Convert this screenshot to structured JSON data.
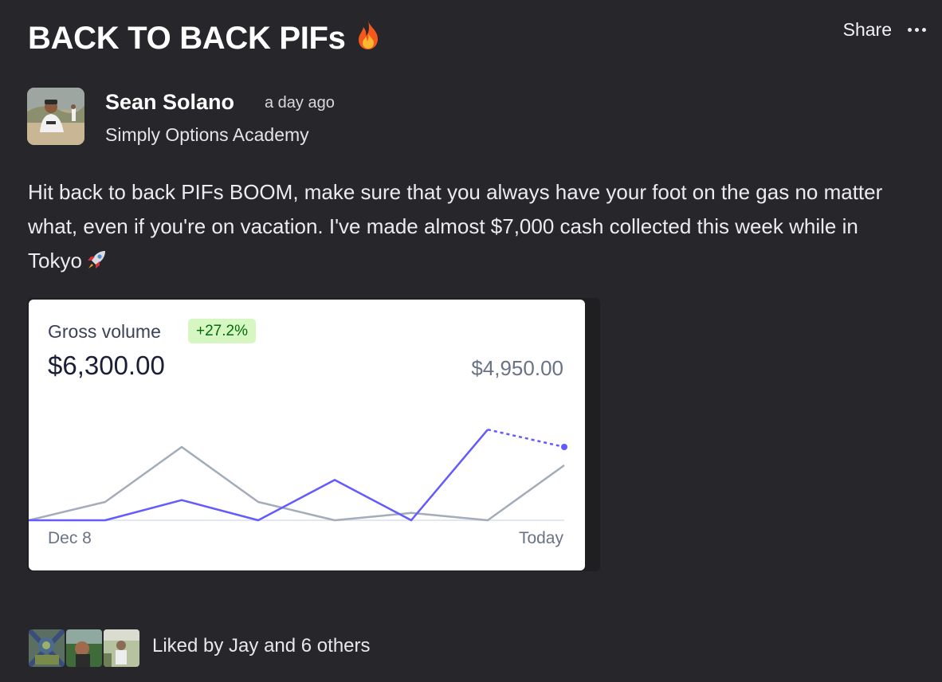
{
  "post": {
    "title": "BACK TO BACK PIFs",
    "title_emoji": "fire-icon",
    "share_label": "Share",
    "more_icon": "more-horizontal-icon",
    "author_name": "Sean Solano",
    "time_ago": "a day ago",
    "community": "Simply Options Academy",
    "body": "Hit back to back PIFs BOOM, make sure that you always have your foot on the gas no matter what, even if you're on vacation. I've made almost $7,000 cash collected this week while in Tokyo",
    "body_emoji": "rocket-icon"
  },
  "likes": {
    "text": "Liked by Jay and 6 others"
  },
  "colors": {
    "background": "#27272b",
    "current_series": "#635bff",
    "previous_series": "#a3acb9",
    "badge_bg": "#d7f7c2",
    "badge_text": "#05690d"
  },
  "chart_data": {
    "type": "line",
    "metric_label": "Gross volume",
    "change": "+27.2%",
    "current_total": "$6,300.00",
    "previous_total": "$4,950.00",
    "x_labels": [
      "Dec 8",
      "Today"
    ],
    "x_count": 8,
    "series": [
      {
        "values": [
          0,
          0,
          1100,
          0,
          2200,
          0,
          4950,
          4000
        ],
        "projected_from_index": 6
      },
      {
        "values": [
          0,
          1000,
          4000,
          1000,
          0,
          400,
          0,
          3000
        ]
      }
    ],
    "ylim": [
      0,
      5000
    ],
    "grid": false
  }
}
